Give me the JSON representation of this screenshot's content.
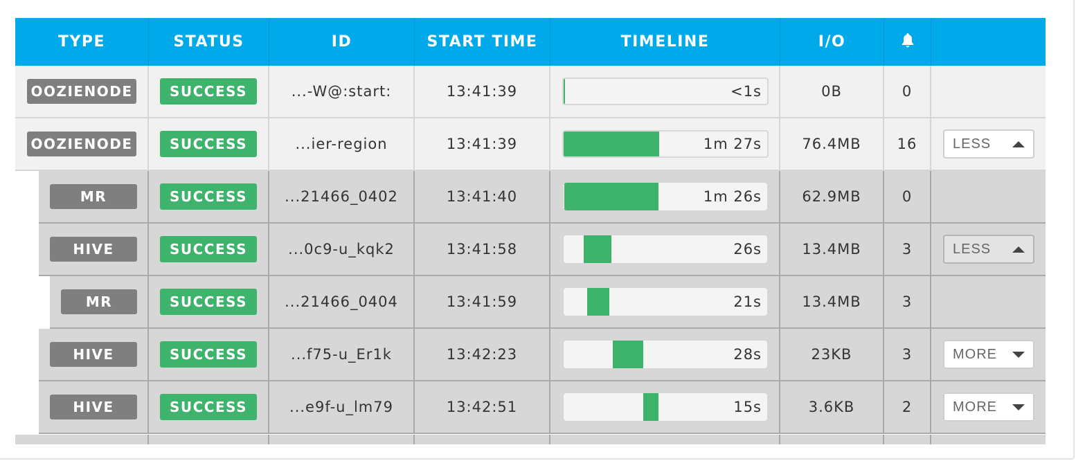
{
  "header": {
    "type": "TYPE",
    "status": "STATUS",
    "id": "ID",
    "start_time": "START TIME",
    "timeline": "TIMELINE",
    "io": "I/O",
    "alerts_icon": "bell-icon"
  },
  "colors": {
    "header_bg": "#00aaea",
    "success": "#3db36b",
    "type_badge": "#7f7f7f",
    "row_light": "#f1f1f1",
    "row_dark": "#d7d7d7"
  },
  "rows": [
    {
      "type": "OOZIENODE",
      "status": "SUCCESS",
      "id": "...-W@:start:",
      "start_time": "13:41:39",
      "duration": "<1s",
      "io": "0B",
      "alerts": "0",
      "toggle": "",
      "progress_start": 0,
      "progress_width": 0.008
    },
    {
      "type": "OOZIENODE",
      "status": "SUCCESS",
      "id": "...ier-region",
      "start_time": "13:41:39",
      "duration": "1m 27s",
      "io": "76.4MB",
      "alerts": "16",
      "toggle": "LESS",
      "progress_start": 0,
      "progress_width": 0.47
    },
    {
      "type": "MR",
      "status": "SUCCESS",
      "id": "...21466_0402",
      "start_time": "13:41:40",
      "duration": "1m 26s",
      "io": "62.9MB",
      "alerts": "0",
      "toggle": "",
      "progress_start": 0.005,
      "progress_width": 0.46
    },
    {
      "type": "HIVE",
      "status": "SUCCESS",
      "id": "...0c9-u_kqk2",
      "start_time": "13:41:58",
      "duration": "26s",
      "io": "13.4MB",
      "alerts": "3",
      "toggle": "LESS",
      "progress_start": 0.1,
      "progress_width": 0.135
    },
    {
      "type": "MR",
      "status": "SUCCESS",
      "id": "...21466_0404",
      "start_time": "13:41:59",
      "duration": "21s",
      "io": "13.4MB",
      "alerts": "3",
      "toggle": "",
      "progress_start": 0.115,
      "progress_width": 0.11
    },
    {
      "type": "HIVE",
      "status": "SUCCESS",
      "id": "...f75-u_Er1k",
      "start_time": "13:42:23",
      "duration": "28s",
      "io": "23KB",
      "alerts": "3",
      "toggle": "MORE",
      "progress_start": 0.24,
      "progress_width": 0.15
    },
    {
      "type": "HIVE",
      "status": "SUCCESS",
      "id": "...e9f-u_lm79",
      "start_time": "13:42:51",
      "duration": "15s",
      "io": "3.6KB",
      "alerts": "2",
      "toggle": "MORE",
      "progress_start": 0.39,
      "progress_width": 0.075
    }
  ]
}
